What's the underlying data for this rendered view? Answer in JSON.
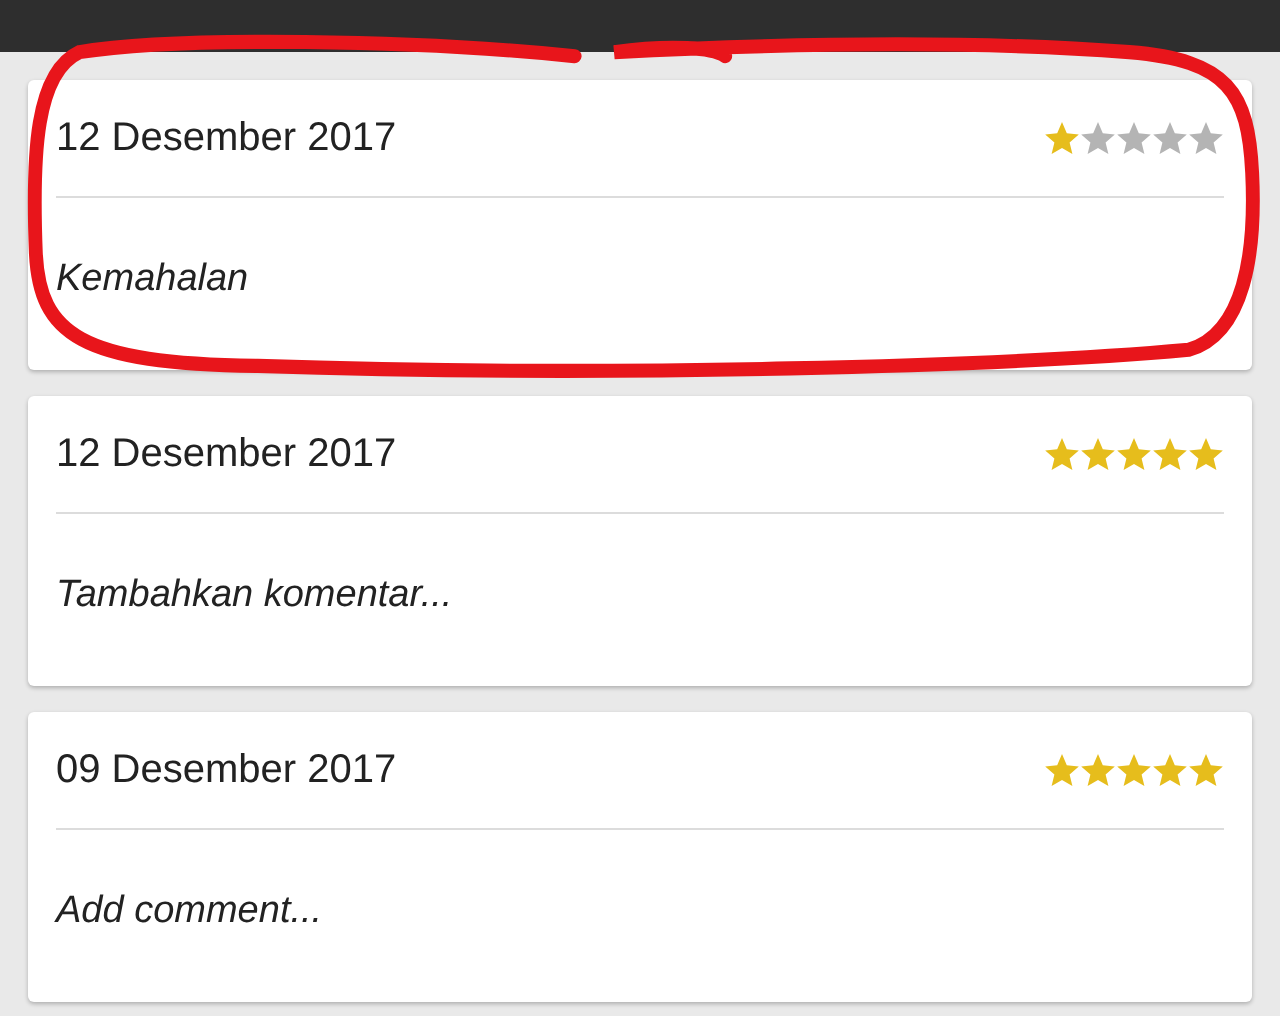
{
  "reviews": [
    {
      "date": "12 Desember 2017",
      "stars": 1,
      "comment": "Kemahalan",
      "highlighted": true
    },
    {
      "date": "12 Desember 2017",
      "stars": 5,
      "comment": "Tambahkan komentar...",
      "highlighted": false
    },
    {
      "date": "09 Desember 2017",
      "stars": 5,
      "comment": "Add comment...",
      "highlighted": false
    }
  ]
}
